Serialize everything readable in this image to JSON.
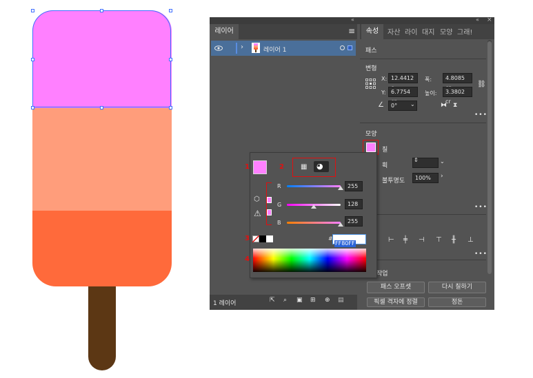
{
  "layers_panel": {
    "tab_label": "레이어",
    "layer_name": "레이어 1",
    "footer_count": "1 레이어"
  },
  "properties_panel": {
    "tabs": [
      "속성",
      "자산",
      "라이",
      "대지",
      "모양",
      "그래!"
    ],
    "section_path": "패스",
    "section_transform": "변형",
    "x_label": "X:",
    "x_value": "12.4412 c",
    "y_label": "Y:",
    "y_value": "6.7754 cn",
    "w_label": "폭:",
    "w_value": "4.8085 cn",
    "h_label": "높이:",
    "h_value": "3.3802 cr",
    "angle_value": "0°",
    "section_appearance": "모양",
    "fill_label": "칠",
    "stroke_label": "획",
    "opacity_label": "불투명도",
    "opacity_value": "100%",
    "section_quick_actions": "작업",
    "btn_offset_path": "패스 오프셋",
    "btn_recolor": "다시 칠하기",
    "btn_align_pixel": "픽셀 격자에 정렬",
    "btn_arrange": "정돈"
  },
  "color_picker": {
    "r_label": "R",
    "g_label": "G",
    "b_label": "B",
    "r_value": "255",
    "g_value": "128",
    "b_value": "255",
    "r_level": 1.0,
    "g_level": 0.5,
    "b_level": 1.0,
    "hex_prefix": "#",
    "hex_value": "FF80FF",
    "callout_1": "1",
    "callout_2": "2",
    "callout_3": "3",
    "callout_4": "4"
  },
  "colors": {
    "fill": "#ff80ff",
    "pop_top": "#ff80ff",
    "pop_mid": "#ff9d7b",
    "pop_bottom": "#ff6a3b",
    "stick": "#5c3714",
    "selection": "#3f6fff",
    "callout_red": "#e01010"
  }
}
